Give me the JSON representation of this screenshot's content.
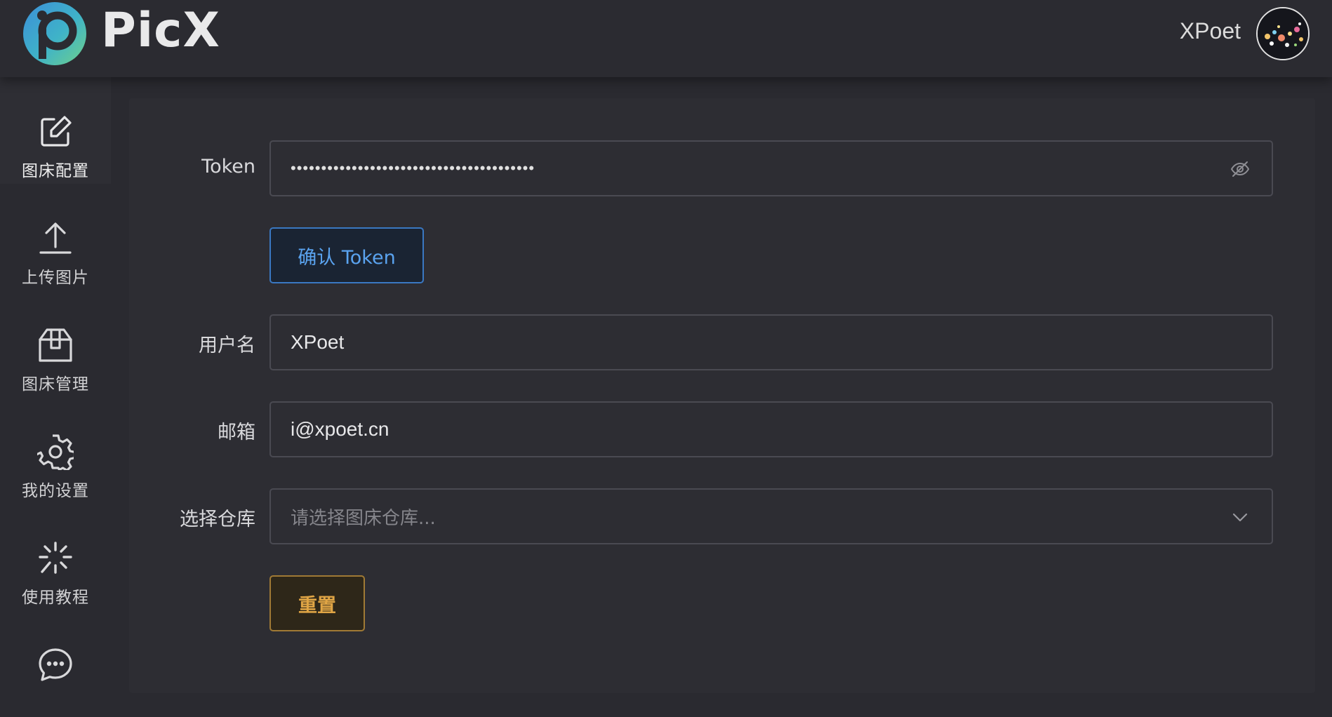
{
  "app": {
    "name": "PicX",
    "user_name": "XPoet"
  },
  "sidebar": {
    "items": [
      {
        "label": "图床配置",
        "icon": "edit-icon",
        "active": true
      },
      {
        "label": "上传图片",
        "icon": "upload-icon",
        "active": false
      },
      {
        "label": "图床管理",
        "icon": "box-icon",
        "active": false
      },
      {
        "label": "我的设置",
        "icon": "gear-icon",
        "active": false
      },
      {
        "label": "使用教程",
        "icon": "sparkle-icon",
        "active": false
      },
      {
        "label": "",
        "icon": "chat-icon",
        "active": false
      }
    ]
  },
  "form": {
    "token": {
      "label": "Token",
      "value": "••••••••••••••••••••••••••••••••••••••••",
      "toggle_icon": "eye-off-icon"
    },
    "confirm_button": "确认 Token",
    "username": {
      "label": "用户名",
      "value": "XPoet"
    },
    "email": {
      "label": "邮箱",
      "value": "i@xpoet.cn"
    },
    "repo": {
      "label": "选择仓库",
      "placeholder": "请选择图床仓库...",
      "icon": "chevron-down-icon"
    },
    "reset_button": "重置"
  },
  "colors": {
    "background": "#2a2a30",
    "primary": "#5aa3ef",
    "warning": "#e0a545"
  }
}
